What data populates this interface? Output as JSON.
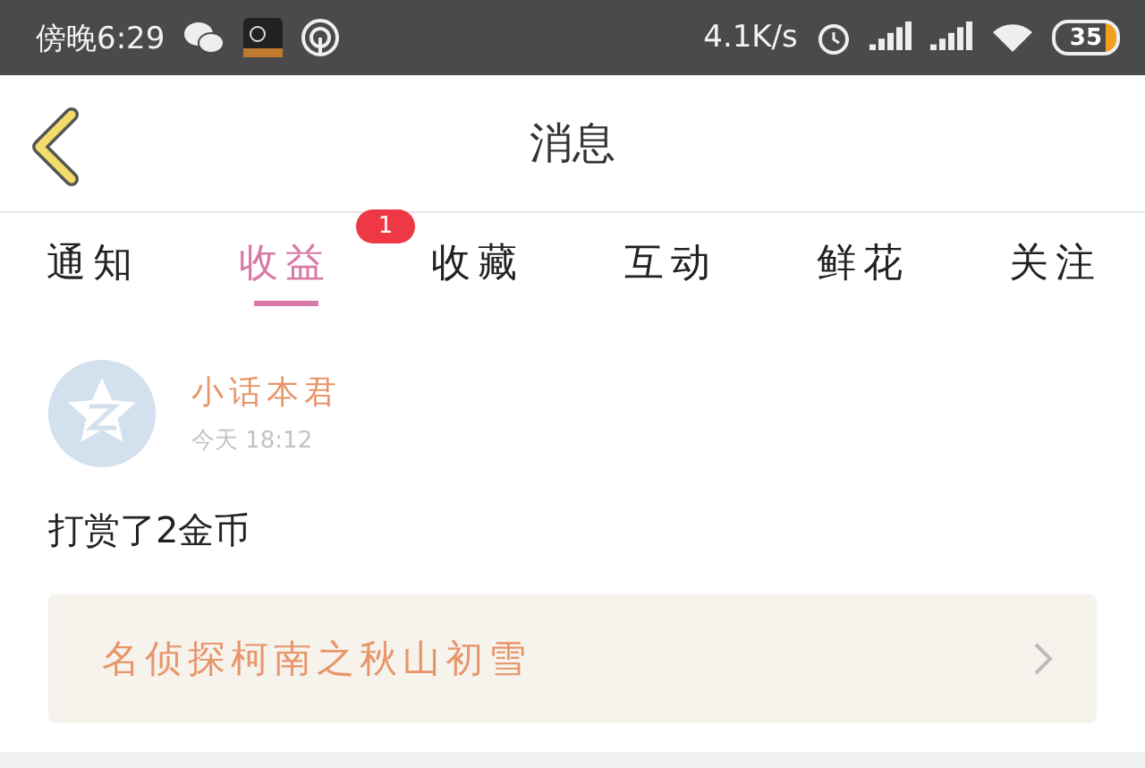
{
  "status_bar": {
    "time": "傍晚6:29",
    "speed": "4.1K/s",
    "battery": "35"
  },
  "header": {
    "title": "消息"
  },
  "tabs": [
    {
      "label": "通知",
      "selected": false
    },
    {
      "label": "收益",
      "selected": true,
      "badge": "1"
    },
    {
      "label": "收藏",
      "selected": false
    },
    {
      "label": "互动",
      "selected": false
    },
    {
      "label": "鲜花",
      "selected": false
    },
    {
      "label": "关注",
      "selected": false
    }
  ],
  "message": {
    "sender": "小话本君",
    "time": "今天 18:12",
    "text": "打赏了2金币",
    "link": "名侦探柯南之秋山初雪"
  }
}
